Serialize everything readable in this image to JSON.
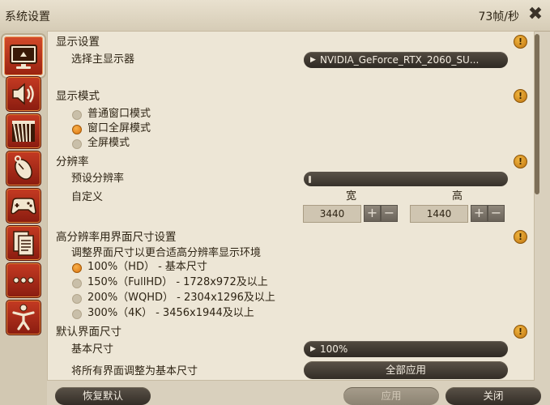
{
  "window": {
    "title": "系统设置",
    "fps": "73帧/秒"
  },
  "sidebar": {
    "items": [
      {
        "icon": "display-monitor-icon",
        "active": true
      },
      {
        "icon": "speaker-volume-icon",
        "active": false
      },
      {
        "icon": "curtain-theater-icon",
        "active": false
      },
      {
        "icon": "mouse-icon",
        "active": false
      },
      {
        "icon": "gamepad-icon",
        "active": false
      },
      {
        "icon": "document-log-icon",
        "active": false
      },
      {
        "icon": "more-dots-icon",
        "active": false
      },
      {
        "icon": "accessibility-figure-icon",
        "active": false
      }
    ]
  },
  "display": {
    "header": "显示设置",
    "main_display_label": "选择主显示器",
    "main_display_value": "NVIDIA_GeForce_RTX_2060_SU..."
  },
  "mode": {
    "header": "显示模式",
    "options": [
      "普通窗口模式",
      "窗口全屏模式",
      "全屏模式"
    ],
    "selected": 1
  },
  "resolution": {
    "header": "分辨率",
    "preset_label": "预设分辨率",
    "custom_label": "自定义",
    "width_label": "宽",
    "height_label": "高",
    "width_value": "3440",
    "height_value": "1440",
    "plus": "+",
    "minus": "−"
  },
  "hires": {
    "header": "高分辨率用界面尺寸设置",
    "desc": "调整界面尺寸以更合适高分辨率显示环境",
    "options": [
      "100%（HD）  - 基本尺寸",
      "150%（FullHD）  - 1728x972及以上",
      "200%（WQHD）  - 2304x1296及以上",
      "300%（4K）  - 3456x1944及以上"
    ],
    "selected": 0
  },
  "default_ui": {
    "header": "默认界面尺寸",
    "base_label": "基本尺寸",
    "base_value": "100%",
    "reset_all_label": "将所有界面调整为基本尺寸",
    "apply_all_button": "全部应用"
  },
  "footer": {
    "restore_default": "恢复默认",
    "apply": "应用",
    "close": "关闭"
  },
  "warn_symbol": "!",
  "colors": {
    "accent_orange": "#dd7410",
    "icon_red": "#c43a22",
    "dark_control": "#332d26"
  }
}
